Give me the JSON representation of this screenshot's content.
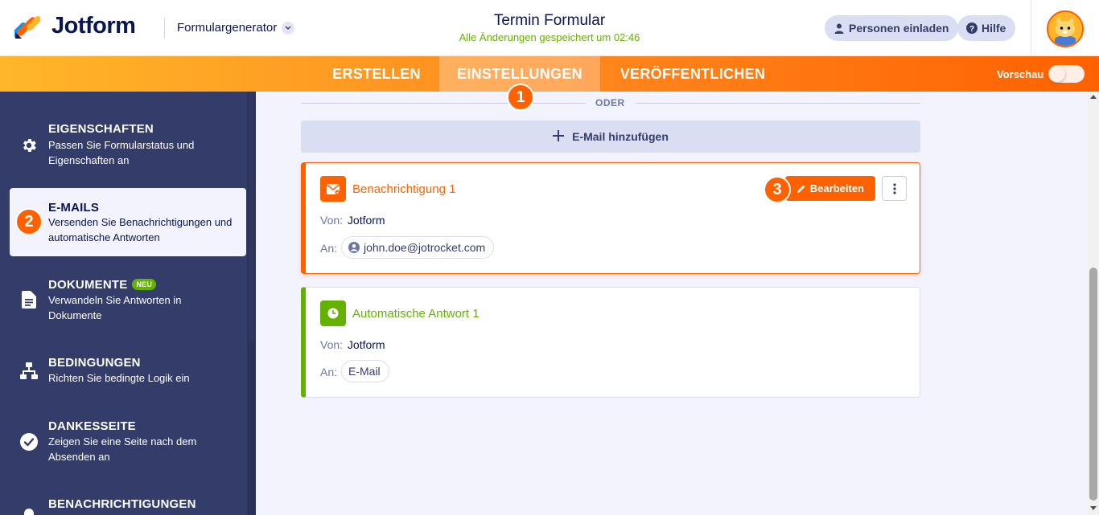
{
  "header": {
    "logo_text": "Jotform",
    "generator_label": "Formulargenerator",
    "form_title": "Termin Formular",
    "saved_status": "Alle Änderungen gespeichert um 02:46",
    "invite_label": "Personen einladen",
    "help_label": "Hilfe"
  },
  "tabs": [
    {
      "label": "ERSTELLEN",
      "active": false
    },
    {
      "label": "EINSTELLUNGEN",
      "active": true
    },
    {
      "label": "VERÖFFENTLICHEN",
      "active": false
    }
  ],
  "preview": {
    "label": "Vorschau",
    "on": false
  },
  "steps": [
    "1",
    "2",
    "3"
  ],
  "sidebar": {
    "items": [
      {
        "title": "EIGENSCHAFTEN",
        "desc": "Passen Sie Formularstatus und Eigenschaften an",
        "icon": "gear-icon"
      },
      {
        "title": "E-MAILS",
        "desc": "Versenden Sie Benachrichtigungen und automatische Antworten",
        "icon": "email-icon",
        "active": true
      },
      {
        "title": "DOKUMENTE",
        "badge": "NEU",
        "desc": "Verwandeln Sie Antworten in Dokumente",
        "icon": "document-icon"
      },
      {
        "title": "BEDINGUNGEN",
        "desc": "Richten Sie bedingte Logik ein",
        "icon": "sitemap-icon"
      },
      {
        "title": "DANKESSEITE",
        "desc": "Zeigen Sie eine Seite nach dem Absenden an",
        "icon": "check-circle-icon"
      },
      {
        "title": "BENACHRICHTIGUNGEN",
        "desc": "",
        "icon": "bell-icon"
      }
    ]
  },
  "main": {
    "divider_label": "ODER",
    "add_email_label": "E-Mail hinzufügen",
    "cards": [
      {
        "title": "Benachrichtigung 1",
        "from_label": "Von:",
        "from_value": "Jotform",
        "to_label": "An:",
        "to_value": "john.doe@jotrocket.com",
        "edit_label": "Bearbeiten",
        "color": "#ff6100"
      },
      {
        "title": "Automatische Antwort 1",
        "from_label": "Von:",
        "from_value": "Jotform",
        "to_label": "An:",
        "to_value": "E-Mail",
        "color": "#64b200"
      }
    ]
  }
}
